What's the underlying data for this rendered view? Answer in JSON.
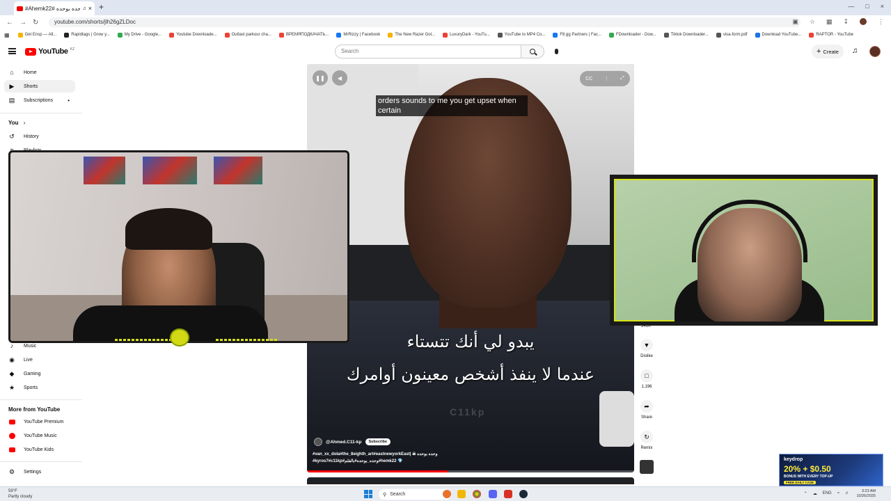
{
  "browser": {
    "tab_title": "#Ahemk22# وحده بوحده",
    "url": "youtube.com/shorts/jlh26gZLDoc",
    "bookmarks": [
      {
        "label": "Get Ensp — All...",
        "color": "#f4b400"
      },
      {
        "label": "Rapidtags | Grow y...",
        "color": "#222222"
      },
      {
        "label": "My Drive - Google...",
        "color": "#34a853"
      },
      {
        "label": "Youtube Downloade...",
        "color": "#ea4335"
      },
      {
        "label": "Outlast parkour cha...",
        "color": "#ea4335"
      },
      {
        "label": "ВРЕМЯПОДКАЧАТЬ...",
        "color": "#ea4335"
      },
      {
        "label": "MrRizzy | Facebook",
        "color": "#1877f2"
      },
      {
        "label": "The New Razer Gol...",
        "color": "#f4b400"
      },
      {
        "label": "LuxuryDark - YouTu...",
        "color": "#ea4335"
      },
      {
        "label": "YouTube to MP4 Co...",
        "color": "#555555"
      },
      {
        "label": "F8.gg Partners | Fac...",
        "color": "#1877f2"
      },
      {
        "label": "FDownloader - Dow...",
        "color": "#34a853"
      },
      {
        "label": "Tiktok Downloader...",
        "color": "#555555"
      },
      {
        "label": "visa-form.pdf",
        "color": "#555555"
      },
      {
        "label": "Download YouTube...",
        "color": "#1a73e8"
      },
      {
        "label": "RAPTOR - YouTube",
        "color": "#ea4335"
      }
    ]
  },
  "header": {
    "logo_text": "YouTube",
    "logo_region": "KZ",
    "search_placeholder": "Search",
    "create_label": "Create"
  },
  "sidebar": {
    "items_top": [
      {
        "label": "Home",
        "icon": "home-icon",
        "glyph": "⌂"
      },
      {
        "label": "Shorts",
        "icon": "shorts-icon",
        "glyph": "▶"
      },
      {
        "label": "Subscriptions",
        "icon": "subscriptions-icon",
        "glyph": "▤"
      }
    ],
    "you_heading": "You",
    "you_items": [
      {
        "label": "History",
        "icon": "history-icon",
        "glyph": "↺"
      },
      {
        "label": "Playlists",
        "icon": "playlists-icon",
        "glyph": "≡"
      }
    ],
    "explore_items": [
      {
        "label": "Music",
        "icon": "music-icon",
        "glyph": "♪"
      },
      {
        "label": "Live",
        "icon": "live-icon",
        "glyph": "◉"
      },
      {
        "label": "Gaming",
        "icon": "gaming-icon",
        "glyph": "◆"
      },
      {
        "label": "Sports",
        "icon": "sports-icon",
        "glyph": "★"
      }
    ],
    "more_heading": "More from YouTube",
    "more_items": [
      {
        "label": "YouTube Premium",
        "icon": "youtube-premium-icon"
      },
      {
        "label": "YouTube Music",
        "icon": "youtube-music-icon"
      },
      {
        "label": "YouTube Kids",
        "icon": "youtube-kids-icon"
      }
    ],
    "settings_label": "Settings"
  },
  "short": {
    "caption": "orders sounds to me you get upset when certain",
    "arabic_line1": "يبدو لي أنك تتستاء",
    "arabic_line2": "عندما لا ينفذ أشخص معينون أوامرك",
    "watermark": "C11kp",
    "channel": "@Ahmed.C11-kp",
    "subscribe_label": "Subscribe",
    "desc_line1": "#van_xx_dola#the_8eighth_art#eastnewyorkEast| ☠ وحده بوحده",
    "desc_line2": "#kyros7#c11kp#وحده_بوحده#بالفلم#hemk22 💎",
    "progress": 0.43
  },
  "actions": {
    "likes": "241K",
    "dislike_label": "Dislike",
    "comments": "1,196",
    "share_label": "Share",
    "remix_label": "Remix"
  },
  "ad": {
    "brand": "keydrop",
    "headline": "20% + $0.50",
    "sub": "BONUS WITH EVERY TOP-UP",
    "tag": "FREE DAILY CASE"
  },
  "taskbar": {
    "weather_temp": "59°F",
    "weather_desc": "Partly cloudy",
    "search_label": "Search",
    "lang": "ENG",
    "time": "3:23 AM",
    "date": "10/26/2025"
  }
}
